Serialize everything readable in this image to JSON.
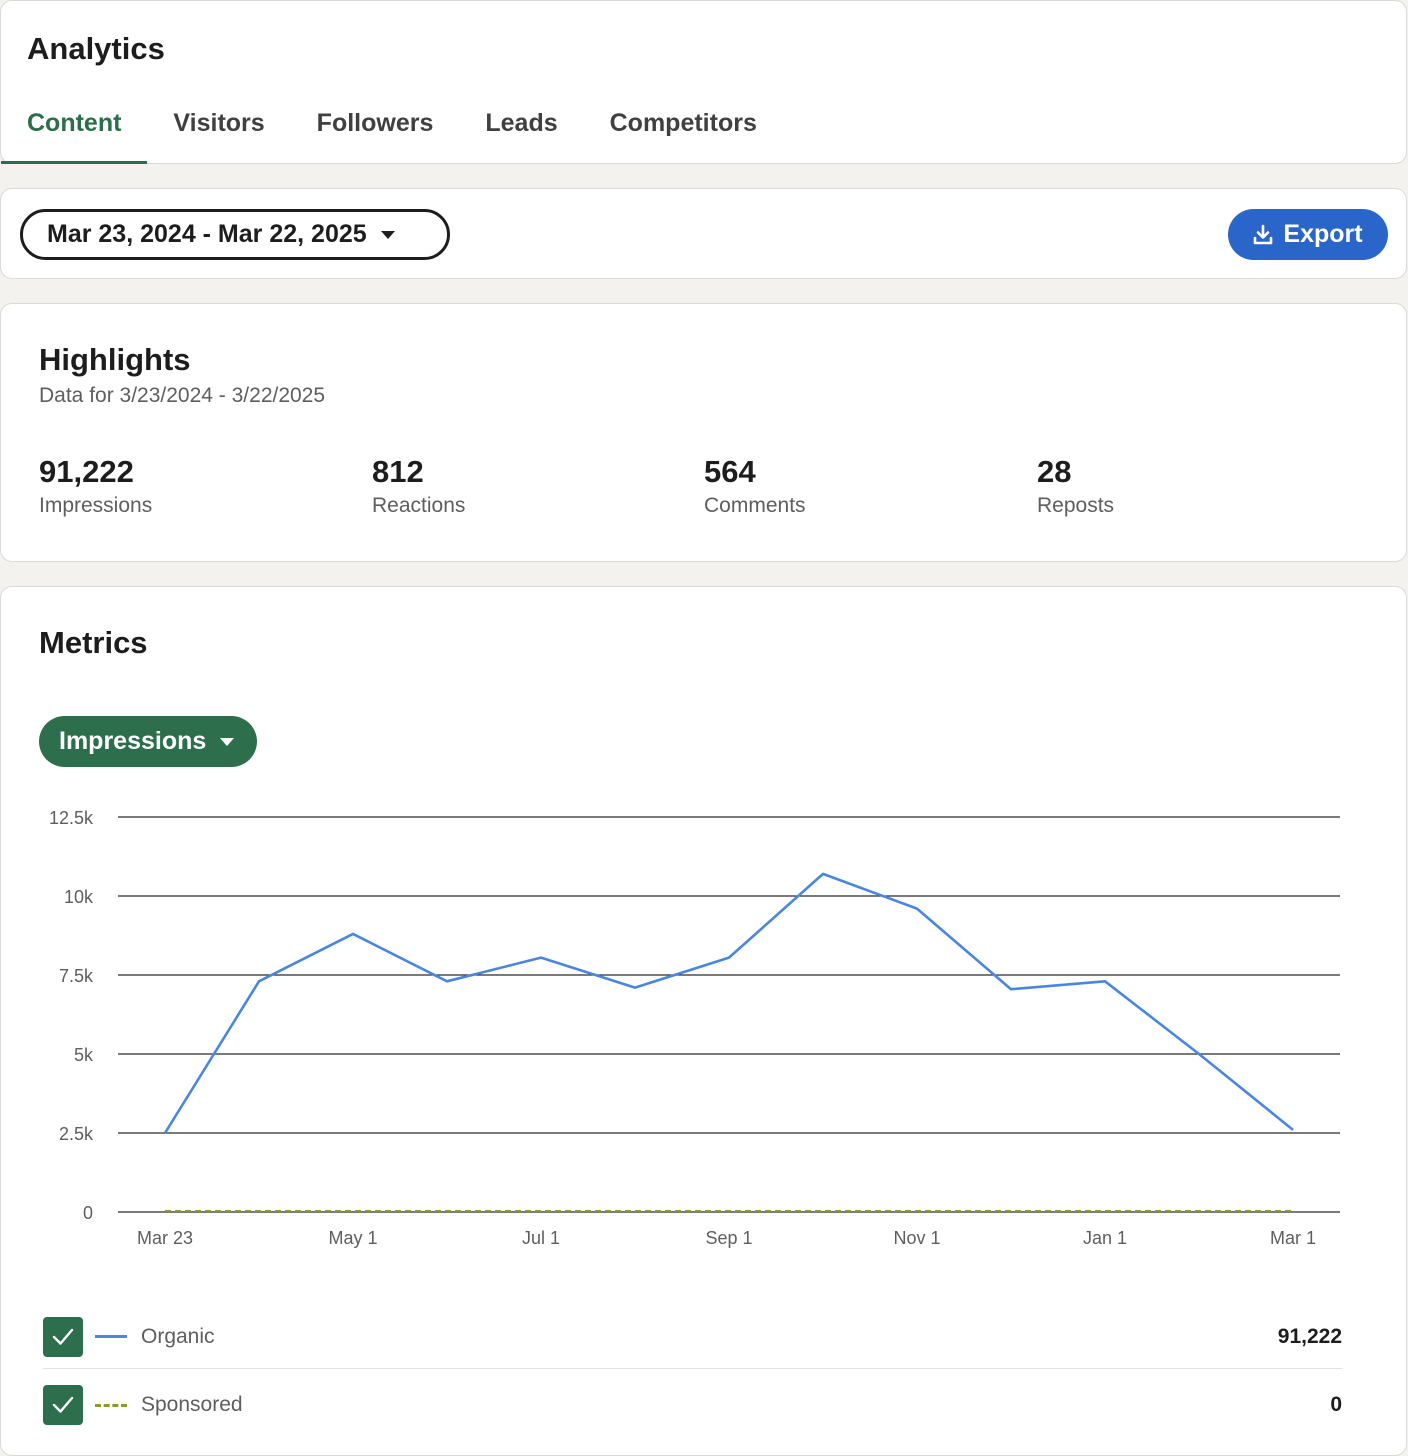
{
  "header": {
    "title": "Analytics",
    "tabs": [
      {
        "label": "Content",
        "active": true
      },
      {
        "label": "Visitors",
        "active": false
      },
      {
        "label": "Followers",
        "active": false
      },
      {
        "label": "Leads",
        "active": false
      },
      {
        "label": "Competitors",
        "active": false
      }
    ]
  },
  "filters": {
    "date_range": "Mar 23, 2024 - Mar 22, 2025",
    "export_label": "Export"
  },
  "highlights": {
    "title": "Highlights",
    "subtitle": "Data for 3/23/2024 - 3/22/2025",
    "stats": [
      {
        "value": "91,222",
        "label": "Impressions"
      },
      {
        "value": "812",
        "label": "Reactions"
      },
      {
        "value": "564",
        "label": "Comments"
      },
      {
        "value": "28",
        "label": "Reposts"
      }
    ]
  },
  "metrics": {
    "title": "Metrics",
    "selected_metric": "Impressions",
    "legend": [
      {
        "name": "Organic",
        "total": "91,222",
        "checked": true,
        "color": "#4a86e0",
        "style": "solid"
      },
      {
        "name": "Sponsored",
        "total": "0",
        "checked": true,
        "color": "#8a9a2c",
        "style": "dashed"
      }
    ]
  },
  "colors": {
    "accent_green": "#2d6e4d",
    "tab_active": "#2b6e4a",
    "export_blue": "#2a66c9",
    "organic_line": "#4a86e0",
    "sponsored_line": "#8a9a2c"
  },
  "icons": {
    "export": "download-icon",
    "caret": "caret-down-icon",
    "check": "check-icon"
  },
  "chart_data": {
    "type": "line",
    "ylim": [
      0,
      12500
    ],
    "y_ticks": [
      0,
      2500,
      5000,
      7500,
      10000,
      12500
    ],
    "y_tick_labels": [
      "0",
      "2.5k",
      "5k",
      "7.5k",
      "10k",
      "12.5k"
    ],
    "x_tick_labels": [
      "Mar 23",
      "May 1",
      "Jul 1",
      "Sep 1",
      "Nov 1",
      "Jan 1",
      "Mar 1"
    ],
    "x_tick_positions": [
      0,
      2,
      4,
      6,
      8,
      10,
      12
    ],
    "grid": true,
    "series": [
      {
        "name": "Organic",
        "values": [
          2500,
          7300,
          8800,
          7300,
          8050,
          7100,
          8050,
          10700,
          9600,
          7050,
          7300,
          5000,
          2600
        ]
      },
      {
        "name": "Sponsored",
        "values": [
          0,
          0,
          0,
          0,
          0,
          0,
          0,
          0,
          0,
          0,
          0,
          0,
          0
        ]
      }
    ]
  }
}
